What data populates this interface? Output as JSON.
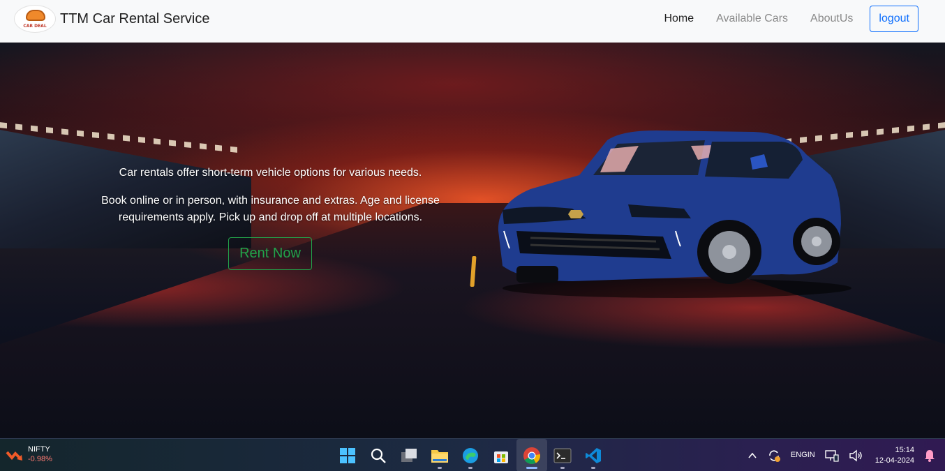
{
  "navbar": {
    "brand_logo_text": "CAR DEAL",
    "brand_title": "TTM Car Rental Service",
    "links": [
      "Home",
      "Available Cars",
      "AboutUs"
    ],
    "logout_label": "logout"
  },
  "hero": {
    "paragraph1": "Car rentals offer short-term vehicle options for various needs.",
    "paragraph2": "Book online or in person, with insurance and extras. Age and license requirements apply. Pick up and drop off at multiple locations.",
    "cta_label": "Rent Now"
  },
  "taskbar": {
    "widget_name": "NIFTY",
    "widget_change": "-0.98%",
    "apps": [
      "start-icon",
      "search-icon",
      "task-view-icon",
      "file-explorer-icon",
      "edge-icon",
      "store-icon",
      "chrome-icon",
      "terminal-icon",
      "vscode-icon"
    ],
    "lang_line1": "ENG",
    "lang_line2": "IN",
    "time": "15:14",
    "date": "12-04-2024"
  },
  "colors": {
    "nav_bg": "#f8f9fa",
    "logout_accent": "#0d6efd",
    "cta_accent": "#22a34a",
    "car_body": "#1f3c8f",
    "widget_negative": "#ff7b73"
  }
}
